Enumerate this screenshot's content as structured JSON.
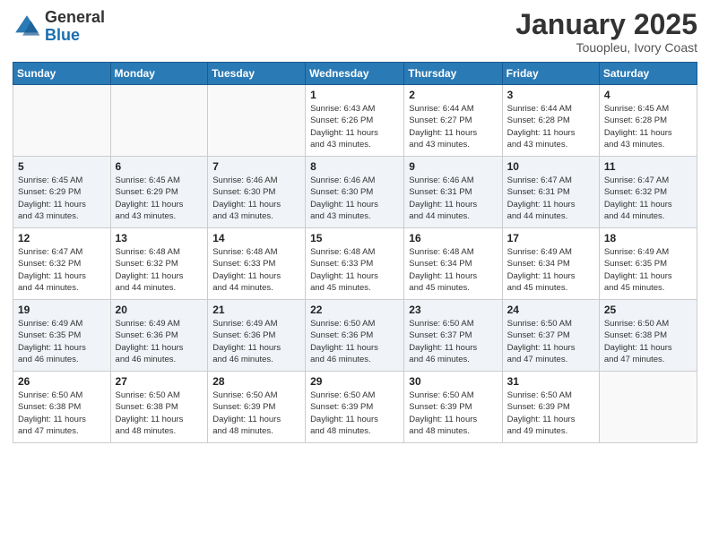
{
  "header": {
    "logo_general": "General",
    "logo_blue": "Blue",
    "month_title": "January 2025",
    "location": "Touopleu, Ivory Coast"
  },
  "days_of_week": [
    "Sunday",
    "Monday",
    "Tuesday",
    "Wednesday",
    "Thursday",
    "Friday",
    "Saturday"
  ],
  "weeks": [
    [
      {
        "day": "",
        "info": ""
      },
      {
        "day": "",
        "info": ""
      },
      {
        "day": "",
        "info": ""
      },
      {
        "day": "1",
        "info": "Sunrise: 6:43 AM\nSunset: 6:26 PM\nDaylight: 11 hours\nand 43 minutes."
      },
      {
        "day": "2",
        "info": "Sunrise: 6:44 AM\nSunset: 6:27 PM\nDaylight: 11 hours\nand 43 minutes."
      },
      {
        "day": "3",
        "info": "Sunrise: 6:44 AM\nSunset: 6:28 PM\nDaylight: 11 hours\nand 43 minutes."
      },
      {
        "day": "4",
        "info": "Sunrise: 6:45 AM\nSunset: 6:28 PM\nDaylight: 11 hours\nand 43 minutes."
      }
    ],
    [
      {
        "day": "5",
        "info": "Sunrise: 6:45 AM\nSunset: 6:29 PM\nDaylight: 11 hours\nand 43 minutes."
      },
      {
        "day": "6",
        "info": "Sunrise: 6:45 AM\nSunset: 6:29 PM\nDaylight: 11 hours\nand 43 minutes."
      },
      {
        "day": "7",
        "info": "Sunrise: 6:46 AM\nSunset: 6:30 PM\nDaylight: 11 hours\nand 43 minutes."
      },
      {
        "day": "8",
        "info": "Sunrise: 6:46 AM\nSunset: 6:30 PM\nDaylight: 11 hours\nand 43 minutes."
      },
      {
        "day": "9",
        "info": "Sunrise: 6:46 AM\nSunset: 6:31 PM\nDaylight: 11 hours\nand 44 minutes."
      },
      {
        "day": "10",
        "info": "Sunrise: 6:47 AM\nSunset: 6:31 PM\nDaylight: 11 hours\nand 44 minutes."
      },
      {
        "day": "11",
        "info": "Sunrise: 6:47 AM\nSunset: 6:32 PM\nDaylight: 11 hours\nand 44 minutes."
      }
    ],
    [
      {
        "day": "12",
        "info": "Sunrise: 6:47 AM\nSunset: 6:32 PM\nDaylight: 11 hours\nand 44 minutes."
      },
      {
        "day": "13",
        "info": "Sunrise: 6:48 AM\nSunset: 6:32 PM\nDaylight: 11 hours\nand 44 minutes."
      },
      {
        "day": "14",
        "info": "Sunrise: 6:48 AM\nSunset: 6:33 PM\nDaylight: 11 hours\nand 44 minutes."
      },
      {
        "day": "15",
        "info": "Sunrise: 6:48 AM\nSunset: 6:33 PM\nDaylight: 11 hours\nand 45 minutes."
      },
      {
        "day": "16",
        "info": "Sunrise: 6:48 AM\nSunset: 6:34 PM\nDaylight: 11 hours\nand 45 minutes."
      },
      {
        "day": "17",
        "info": "Sunrise: 6:49 AM\nSunset: 6:34 PM\nDaylight: 11 hours\nand 45 minutes."
      },
      {
        "day": "18",
        "info": "Sunrise: 6:49 AM\nSunset: 6:35 PM\nDaylight: 11 hours\nand 45 minutes."
      }
    ],
    [
      {
        "day": "19",
        "info": "Sunrise: 6:49 AM\nSunset: 6:35 PM\nDaylight: 11 hours\nand 46 minutes."
      },
      {
        "day": "20",
        "info": "Sunrise: 6:49 AM\nSunset: 6:36 PM\nDaylight: 11 hours\nand 46 minutes."
      },
      {
        "day": "21",
        "info": "Sunrise: 6:49 AM\nSunset: 6:36 PM\nDaylight: 11 hours\nand 46 minutes."
      },
      {
        "day": "22",
        "info": "Sunrise: 6:50 AM\nSunset: 6:36 PM\nDaylight: 11 hours\nand 46 minutes."
      },
      {
        "day": "23",
        "info": "Sunrise: 6:50 AM\nSunset: 6:37 PM\nDaylight: 11 hours\nand 46 minutes."
      },
      {
        "day": "24",
        "info": "Sunrise: 6:50 AM\nSunset: 6:37 PM\nDaylight: 11 hours\nand 47 minutes."
      },
      {
        "day": "25",
        "info": "Sunrise: 6:50 AM\nSunset: 6:38 PM\nDaylight: 11 hours\nand 47 minutes."
      }
    ],
    [
      {
        "day": "26",
        "info": "Sunrise: 6:50 AM\nSunset: 6:38 PM\nDaylight: 11 hours\nand 47 minutes."
      },
      {
        "day": "27",
        "info": "Sunrise: 6:50 AM\nSunset: 6:38 PM\nDaylight: 11 hours\nand 48 minutes."
      },
      {
        "day": "28",
        "info": "Sunrise: 6:50 AM\nSunset: 6:39 PM\nDaylight: 11 hours\nand 48 minutes."
      },
      {
        "day": "29",
        "info": "Sunrise: 6:50 AM\nSunset: 6:39 PM\nDaylight: 11 hours\nand 48 minutes."
      },
      {
        "day": "30",
        "info": "Sunrise: 6:50 AM\nSunset: 6:39 PM\nDaylight: 11 hours\nand 48 minutes."
      },
      {
        "day": "31",
        "info": "Sunrise: 6:50 AM\nSunset: 6:39 PM\nDaylight: 11 hours\nand 49 minutes."
      },
      {
        "day": "",
        "info": ""
      }
    ]
  ]
}
